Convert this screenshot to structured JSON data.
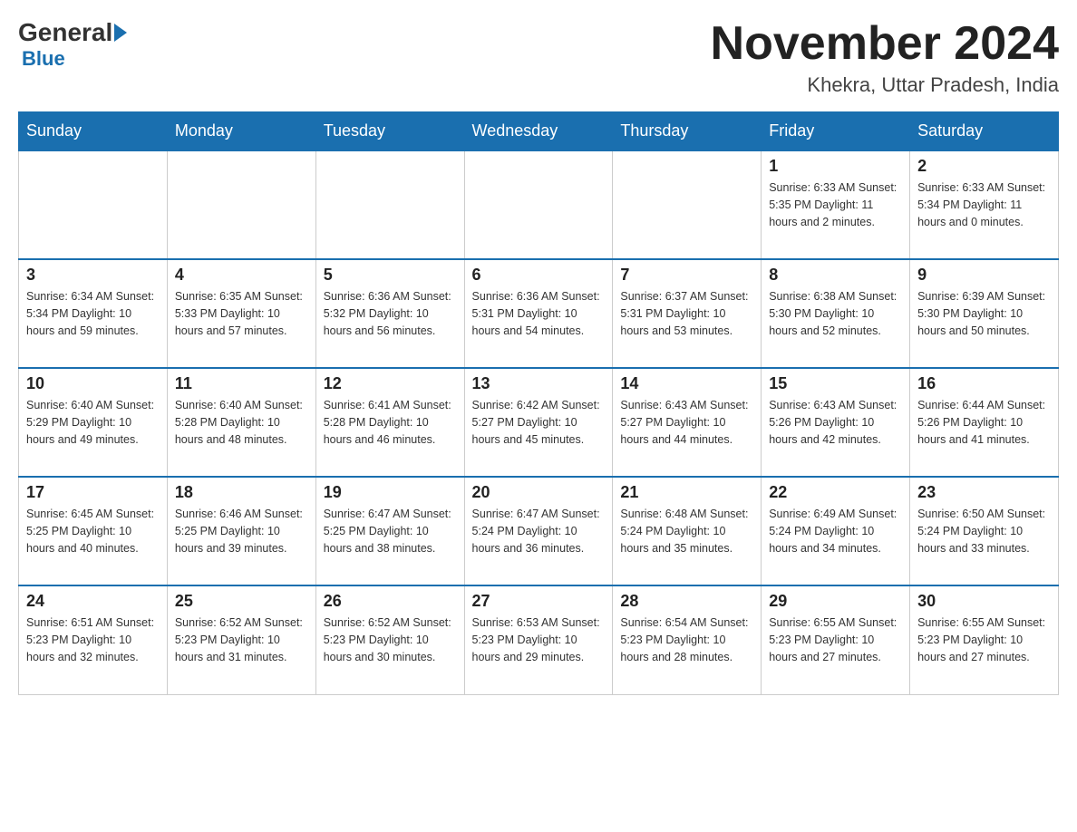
{
  "header": {
    "logo_general": "General",
    "logo_blue": "Blue",
    "month_title": "November 2024",
    "location": "Khekra, Uttar Pradesh, India"
  },
  "weekdays": [
    "Sunday",
    "Monday",
    "Tuesday",
    "Wednesday",
    "Thursday",
    "Friday",
    "Saturday"
  ],
  "weeks": [
    [
      {
        "day": "",
        "info": ""
      },
      {
        "day": "",
        "info": ""
      },
      {
        "day": "",
        "info": ""
      },
      {
        "day": "",
        "info": ""
      },
      {
        "day": "",
        "info": ""
      },
      {
        "day": "1",
        "info": "Sunrise: 6:33 AM\nSunset: 5:35 PM\nDaylight: 11 hours and 2 minutes."
      },
      {
        "day": "2",
        "info": "Sunrise: 6:33 AM\nSunset: 5:34 PM\nDaylight: 11 hours and 0 minutes."
      }
    ],
    [
      {
        "day": "3",
        "info": "Sunrise: 6:34 AM\nSunset: 5:34 PM\nDaylight: 10 hours and 59 minutes."
      },
      {
        "day": "4",
        "info": "Sunrise: 6:35 AM\nSunset: 5:33 PM\nDaylight: 10 hours and 57 minutes."
      },
      {
        "day": "5",
        "info": "Sunrise: 6:36 AM\nSunset: 5:32 PM\nDaylight: 10 hours and 56 minutes."
      },
      {
        "day": "6",
        "info": "Sunrise: 6:36 AM\nSunset: 5:31 PM\nDaylight: 10 hours and 54 minutes."
      },
      {
        "day": "7",
        "info": "Sunrise: 6:37 AM\nSunset: 5:31 PM\nDaylight: 10 hours and 53 minutes."
      },
      {
        "day": "8",
        "info": "Sunrise: 6:38 AM\nSunset: 5:30 PM\nDaylight: 10 hours and 52 minutes."
      },
      {
        "day": "9",
        "info": "Sunrise: 6:39 AM\nSunset: 5:30 PM\nDaylight: 10 hours and 50 minutes."
      }
    ],
    [
      {
        "day": "10",
        "info": "Sunrise: 6:40 AM\nSunset: 5:29 PM\nDaylight: 10 hours and 49 minutes."
      },
      {
        "day": "11",
        "info": "Sunrise: 6:40 AM\nSunset: 5:28 PM\nDaylight: 10 hours and 48 minutes."
      },
      {
        "day": "12",
        "info": "Sunrise: 6:41 AM\nSunset: 5:28 PM\nDaylight: 10 hours and 46 minutes."
      },
      {
        "day": "13",
        "info": "Sunrise: 6:42 AM\nSunset: 5:27 PM\nDaylight: 10 hours and 45 minutes."
      },
      {
        "day": "14",
        "info": "Sunrise: 6:43 AM\nSunset: 5:27 PM\nDaylight: 10 hours and 44 minutes."
      },
      {
        "day": "15",
        "info": "Sunrise: 6:43 AM\nSunset: 5:26 PM\nDaylight: 10 hours and 42 minutes."
      },
      {
        "day": "16",
        "info": "Sunrise: 6:44 AM\nSunset: 5:26 PM\nDaylight: 10 hours and 41 minutes."
      }
    ],
    [
      {
        "day": "17",
        "info": "Sunrise: 6:45 AM\nSunset: 5:25 PM\nDaylight: 10 hours and 40 minutes."
      },
      {
        "day": "18",
        "info": "Sunrise: 6:46 AM\nSunset: 5:25 PM\nDaylight: 10 hours and 39 minutes."
      },
      {
        "day": "19",
        "info": "Sunrise: 6:47 AM\nSunset: 5:25 PM\nDaylight: 10 hours and 38 minutes."
      },
      {
        "day": "20",
        "info": "Sunrise: 6:47 AM\nSunset: 5:24 PM\nDaylight: 10 hours and 36 minutes."
      },
      {
        "day": "21",
        "info": "Sunrise: 6:48 AM\nSunset: 5:24 PM\nDaylight: 10 hours and 35 minutes."
      },
      {
        "day": "22",
        "info": "Sunrise: 6:49 AM\nSunset: 5:24 PM\nDaylight: 10 hours and 34 minutes."
      },
      {
        "day": "23",
        "info": "Sunrise: 6:50 AM\nSunset: 5:24 PM\nDaylight: 10 hours and 33 minutes."
      }
    ],
    [
      {
        "day": "24",
        "info": "Sunrise: 6:51 AM\nSunset: 5:23 PM\nDaylight: 10 hours and 32 minutes."
      },
      {
        "day": "25",
        "info": "Sunrise: 6:52 AM\nSunset: 5:23 PM\nDaylight: 10 hours and 31 minutes."
      },
      {
        "day": "26",
        "info": "Sunrise: 6:52 AM\nSunset: 5:23 PM\nDaylight: 10 hours and 30 minutes."
      },
      {
        "day": "27",
        "info": "Sunrise: 6:53 AM\nSunset: 5:23 PM\nDaylight: 10 hours and 29 minutes."
      },
      {
        "day": "28",
        "info": "Sunrise: 6:54 AM\nSunset: 5:23 PM\nDaylight: 10 hours and 28 minutes."
      },
      {
        "day": "29",
        "info": "Sunrise: 6:55 AM\nSunset: 5:23 PM\nDaylight: 10 hours and 27 minutes."
      },
      {
        "day": "30",
        "info": "Sunrise: 6:55 AM\nSunset: 5:23 PM\nDaylight: 10 hours and 27 minutes."
      }
    ]
  ]
}
